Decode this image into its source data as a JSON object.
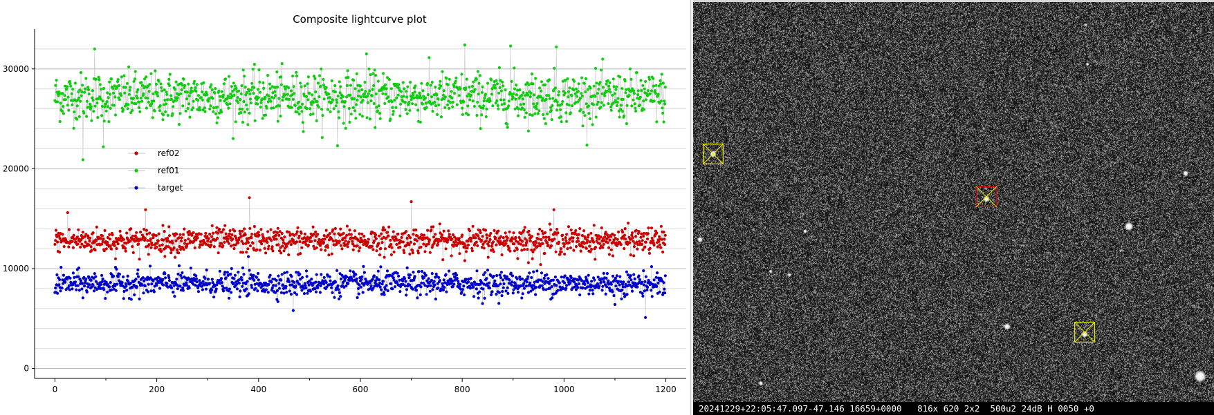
{
  "plot": {
    "title": "Composite lightcurve plot",
    "chart_data": {
      "type": "scatter",
      "title": "Composite lightcurve plot",
      "xlabel": "",
      "ylabel": "",
      "xlim": [
        -40,
        1240
      ],
      "ylim": [
        -1000,
        34000
      ],
      "x_ticks": [
        0,
        200,
        400,
        600,
        800,
        1000,
        1200
      ],
      "y_ticks": [
        0,
        10000,
        20000,
        30000
      ],
      "grid": true,
      "legend_position": "upper-left",
      "n_points": 1200,
      "series": [
        {
          "name": "ref02",
          "color": "#cc0000",
          "mean": 12800,
          "spread": 850,
          "notable": [
            [
              25,
              15600
            ],
            [
              178,
              15900
            ],
            [
              382,
              17100
            ],
            [
              700,
              16700
            ],
            [
              980,
              15900
            ],
            [
              930,
              10600
            ]
          ]
        },
        {
          "name": "ref01",
          "color": "#11cc11",
          "mean": 27200,
          "spread": 1600,
          "notable": [
            [
              55,
              20900
            ],
            [
              78,
              32000
            ],
            [
              612,
              31500
            ],
            [
              805,
              32400
            ],
            [
              895,
              32300
            ],
            [
              985,
              32200
            ],
            [
              555,
              22300
            ],
            [
              95,
              22200
            ]
          ]
        },
        {
          "name": "target",
          "color": "#0000cc",
          "mean": 8500,
          "spread": 800,
          "notable": [
            [
              468,
              5800
            ],
            [
              1160,
              5100
            ],
            [
              380,
              11200
            ],
            [
              1100,
              6400
            ],
            [
              840,
              6500
            ]
          ]
        }
      ]
    }
  },
  "image": {
    "status": "20241229+22:05:47.097-47.146 16659+0000   816x 620 2x2  500u2 24dB H 0050 +0",
    "markers": [
      {
        "name": "reference-star-marker-1",
        "color": "#e8e800",
        "role": "reference"
      },
      {
        "name": "target-star-marker",
        "color": "#dd0000",
        "role": "target"
      },
      {
        "name": "reference-star-marker-2",
        "color": "#e8e800",
        "role": "reference"
      }
    ]
  }
}
